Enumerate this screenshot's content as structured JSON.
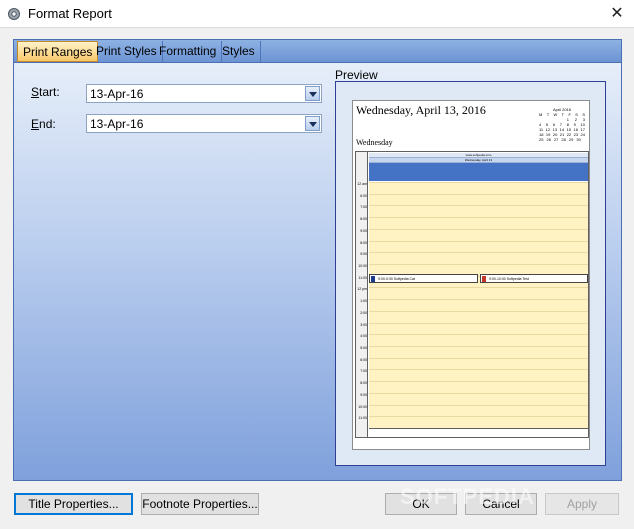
{
  "window": {
    "title": "Format Report",
    "close_symbol": "✕"
  },
  "tabs": [
    {
      "label": "Print Ranges"
    },
    {
      "label": "Print Styles"
    },
    {
      "label": "Formatting"
    },
    {
      "label": "Styles"
    }
  ],
  "range": {
    "start_label_key": "S",
    "start_label_rest": "tart:",
    "start_value": "13-Apr-16",
    "end_label_key": "E",
    "end_label_rest": "nd:",
    "end_value": "13-Apr-16"
  },
  "preview": {
    "label": "Preview",
    "page_title": "Wednesday, April 13, 2016",
    "page_sub": "Wednesday",
    "minical": {
      "month": "April 2016",
      "days": [
        "M",
        "T",
        "W",
        "T",
        "F",
        "S",
        "S"
      ],
      "weeks": [
        [
          "",
          "",
          "",
          "",
          "1",
          "2",
          "3"
        ],
        [
          "4",
          "5",
          "6",
          "7",
          "8",
          "9",
          "10"
        ],
        [
          "11",
          "12",
          "13",
          "14",
          "15",
          "16",
          "17"
        ],
        [
          "18",
          "19",
          "20",
          "21",
          "22",
          "23",
          "24"
        ],
        [
          "25",
          "26",
          "27",
          "28",
          "29",
          "30",
          ""
        ]
      ]
    },
    "header_line1": "www.softpedia.com",
    "header_line2": "Wednesday, April 13",
    "times": [
      "12 am",
      "6:00",
      "7:00",
      "8:00",
      "9:00",
      "8:00",
      "9:00",
      "10:00",
      "11:00",
      "12 pm",
      "1:00",
      "2:00",
      "3:00",
      "4:00",
      "5:00",
      "6:00",
      "7:00",
      "8:00",
      "9:00",
      "10:00",
      "11:00"
    ],
    "appointments": [
      {
        "text": "9:00-9:30 Softpedia Cat"
      },
      {
        "text": "9:00-10:00 Softpedia Test"
      }
    ]
  },
  "buttons": {
    "title_properties": "Title Properties...",
    "footnote_properties": "Footnote Properties...",
    "ok": "OK",
    "cancel": "Cancel",
    "apply": "Apply"
  },
  "watermark": "SOFTPEDIA"
}
